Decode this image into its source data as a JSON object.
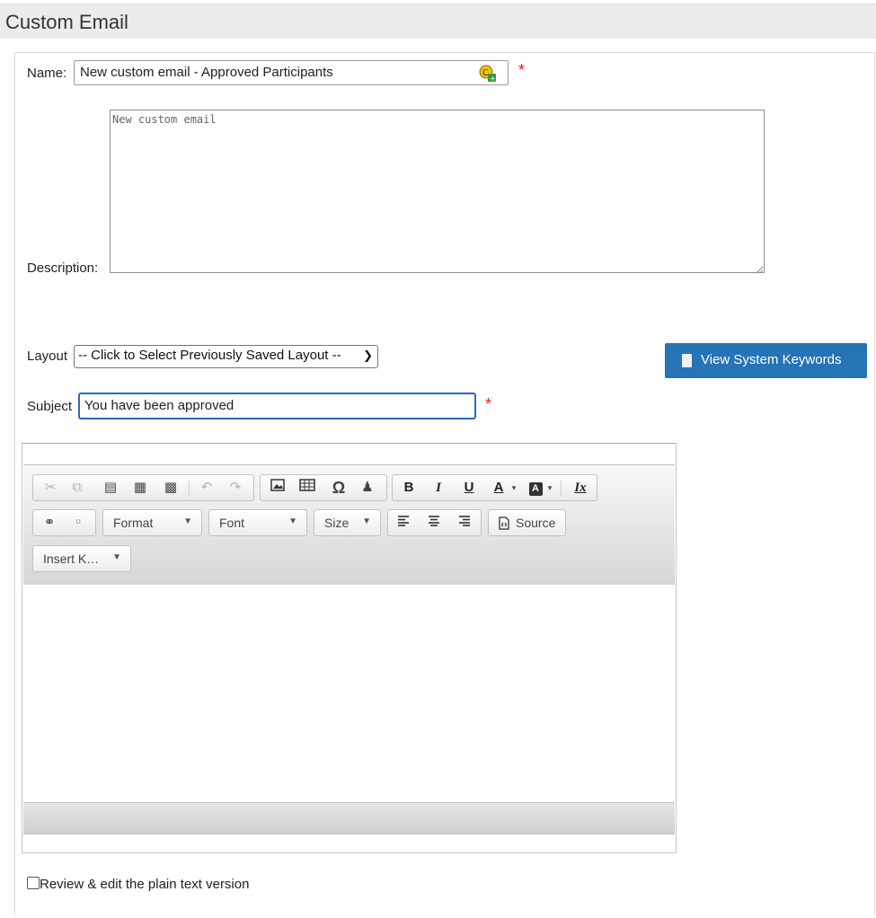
{
  "header": {
    "title": "Custom Email"
  },
  "form": {
    "name_label": "Name:",
    "name_value": "New custom email - Approved Participants",
    "required_mark": "*",
    "description_label": "Description:",
    "description_value": "New custom email",
    "layout_label": "Layout",
    "layout_selected": "-- Click to Select Previously Saved Layout --",
    "subject_label": "Subject",
    "subject_value": "You have been approved",
    "keywords_button": "View System Keywords",
    "plain_text_label": "Review & edit the plain text version",
    "plain_text_checked": false
  },
  "editor": {
    "toolbar": {
      "clipboard": [
        "cut-icon",
        "copy-icon",
        "paste-icon",
        "paste-text-icon",
        "paste-word-icon"
      ],
      "history": [
        "undo-icon",
        "redo-icon"
      ],
      "insert": [
        "image-icon",
        "table-icon",
        "special-char-icon",
        "anchor-icon"
      ],
      "style": [
        "B",
        "I",
        "U",
        "A",
        "A"
      ],
      "remove_format": "Ix",
      "links": [
        "link-icon",
        "unlink-icon"
      ],
      "format_label": "Format",
      "font_label": "Font",
      "size_label": "Size",
      "align": [
        "align-left-icon",
        "align-center-icon",
        "align-right-icon"
      ],
      "source_label": "Source",
      "insert_keyword_label": "Insert K…"
    },
    "body": ""
  },
  "colors": {
    "header_bg": "#ececec",
    "button_blue": "#2673b5",
    "required_red": "#e02020",
    "focus_border": "#2a69c2"
  }
}
